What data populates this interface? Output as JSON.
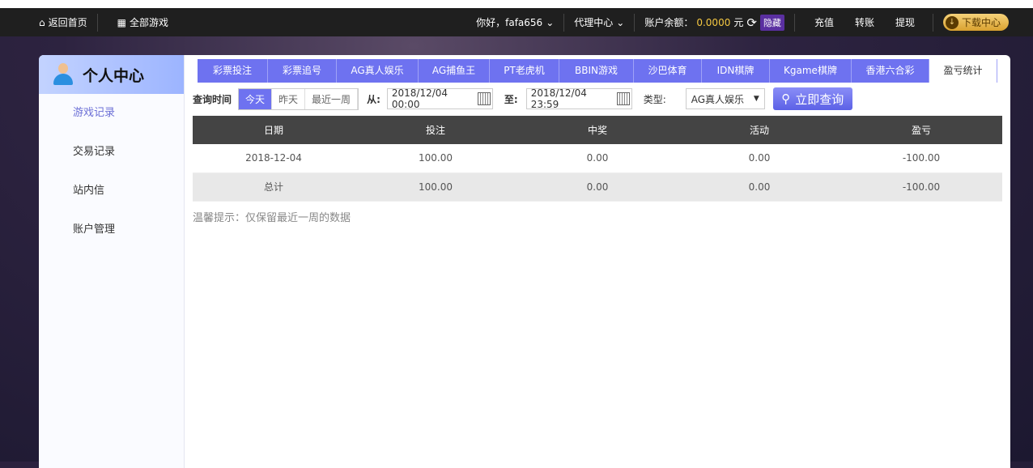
{
  "nav": {
    "home": "返回首页",
    "all_games": "全部游戏",
    "greeting": "你好，fafa656",
    "agent": "代理中心",
    "balance_label": "账户余额：",
    "balance": "0.0000",
    "currency": "元",
    "hide": "隐藏",
    "deposit": "充值",
    "transfer": "转账",
    "withdraw": "提现",
    "download": "下载中心"
  },
  "sidebar": {
    "title": "个人中心",
    "items": [
      {
        "label": "游戏记录"
      },
      {
        "label": "交易记录"
      },
      {
        "label": "站内信"
      },
      {
        "label": "账户管理"
      }
    ]
  },
  "tabs": [
    {
      "label": "彩票投注"
    },
    {
      "label": "彩票追号"
    },
    {
      "label": "AG真人娱乐"
    },
    {
      "label": "AG捕鱼王"
    },
    {
      "label": "PT老虎机"
    },
    {
      "label": "BBIN游戏"
    },
    {
      "label": "沙巴体育"
    },
    {
      "label": "IDN棋牌"
    },
    {
      "label": "Kgame棋牌"
    },
    {
      "label": "香港六合彩"
    },
    {
      "label": "盈亏统计"
    }
  ],
  "query": {
    "label": "查询时间",
    "today": "今天",
    "yesterday": "昨天",
    "week": "最近一周",
    "from_label": "从:",
    "from": "2018/12/04 00:00",
    "to_label": "至:",
    "to": "2018/12/04 23:59",
    "type_label": "类型:",
    "type": "AG真人娱乐",
    "submit": "立即查询"
  },
  "table": {
    "headers": [
      "日期",
      "投注",
      "中奖",
      "活动",
      "盈亏"
    ],
    "rows": [
      [
        "2018-12-04",
        "100.00",
        "0.00",
        "0.00",
        "-100.00"
      ]
    ],
    "total": [
      "总计",
      "100.00",
      "0.00",
      "0.00",
      "-100.00"
    ]
  },
  "tip": "温馨提示：仅保留最近一周的数据"
}
